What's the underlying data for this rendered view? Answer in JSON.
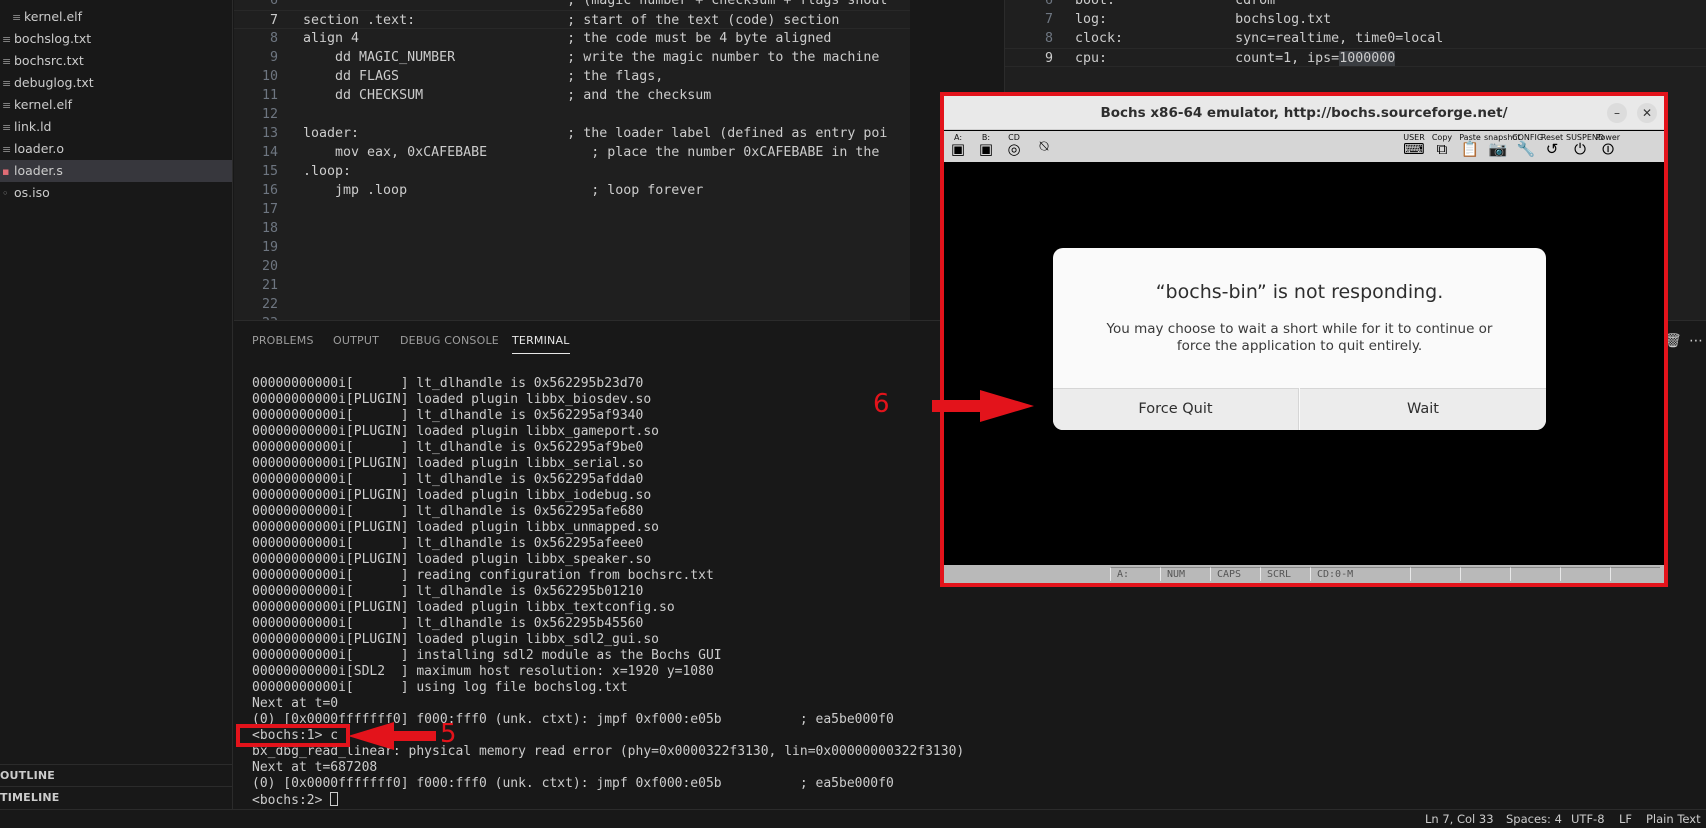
{
  "sidebar": {
    "files": [
      {
        "name": "kernel.elf",
        "icon": "text-file-icon",
        "indent": true
      },
      {
        "name": "bochslog.txt",
        "icon": "text-file-icon"
      },
      {
        "name": "bochsrc.txt",
        "icon": "text-file-icon"
      },
      {
        "name": "debuglog.txt",
        "icon": "text-file-icon"
      },
      {
        "name": "kernel.elf",
        "icon": "text-file-icon"
      },
      {
        "name": "link.ld",
        "icon": "text-file-icon"
      },
      {
        "name": "loader.o",
        "icon": "text-file-icon"
      },
      {
        "name": "loader.s",
        "icon": "asm-file-icon",
        "active": true
      },
      {
        "name": "os.iso",
        "icon": "disc-file-icon"
      }
    ],
    "outline_label": "OUTLINE",
    "timeline_label": "TIMELINE"
  },
  "editor_left": {
    "lines": [
      {
        "num": "6",
        "text": "                                 ; (magic number + checksum + flags shoul"
      },
      {
        "num": "7",
        "text": "section .text:                   ; start of the text (code) section",
        "current": true
      },
      {
        "num": "8",
        "text": "align 4                          ; the code must be 4 byte aligned"
      },
      {
        "num": "9",
        "text": "    dd MAGIC_NUMBER              ; write the magic number to the machine"
      },
      {
        "num": "10",
        "text": "    dd FLAGS                     ; the flags,"
      },
      {
        "num": "11",
        "text": "    dd CHECKSUM                  ; and the checksum"
      },
      {
        "num": "12",
        "text": ""
      },
      {
        "num": "13",
        "text": "loader:                          ; the loader label (defined as entry poi"
      },
      {
        "num": "14",
        "text": "    mov eax, 0xCAFEBABE             ; place the number 0xCAFEBABE in the"
      },
      {
        "num": "15",
        "text": ".loop:"
      },
      {
        "num": "16",
        "text": "    jmp .loop                       ; loop forever"
      },
      {
        "num": "17",
        "text": ""
      },
      {
        "num": "18",
        "text": ""
      },
      {
        "num": "19",
        "text": ""
      },
      {
        "num": "20",
        "text": ""
      },
      {
        "num": "21",
        "text": ""
      },
      {
        "num": "22",
        "text": ""
      },
      {
        "num": "23",
        "text": ""
      }
    ]
  },
  "editor_right": {
    "lines": [
      {
        "num": "6",
        "text": "boot:               cdrom"
      },
      {
        "num": "7",
        "text": "log:                bochslog.txt"
      },
      {
        "num": "8",
        "text": "clock:              sync=realtime, time0=local"
      },
      {
        "num": "9",
        "text": "cpu:                count=1, ips=",
        "selected": "1000000",
        "current": true
      }
    ]
  },
  "panel": {
    "tabs": [
      "PROBLEMS",
      "OUTPUT",
      "DEBUG CONSOLE",
      "TERMINAL"
    ],
    "active_tab": "TERMINAL",
    "terminal_lines": [
      "00000000000i[      ] lt_dlhandle is 0x562295b23d70",
      "00000000000i[PLUGIN] loaded plugin libbx_biosdev.so",
      "00000000000i[      ] lt_dlhandle is 0x562295af9340",
      "00000000000i[PLUGIN] loaded plugin libbx_gameport.so",
      "00000000000i[      ] lt_dlhandle is 0x562295af9be0",
      "00000000000i[PLUGIN] loaded plugin libbx_serial.so",
      "00000000000i[      ] lt_dlhandle is 0x562295afdda0",
      "00000000000i[PLUGIN] loaded plugin libbx_iodebug.so",
      "00000000000i[      ] lt_dlhandle is 0x562295afe680",
      "00000000000i[PLUGIN] loaded plugin libbx_unmapped.so",
      "00000000000i[      ] lt_dlhandle is 0x562295afeee0",
      "00000000000i[PLUGIN] loaded plugin libbx_speaker.so",
      "00000000000i[      ] reading configuration from bochsrc.txt",
      "00000000000i[      ] lt_dlhandle is 0x562295b01210",
      "00000000000i[PLUGIN] loaded plugin libbx_textconfig.so",
      "00000000000i[      ] lt_dlhandle is 0x562295b45560",
      "00000000000i[PLUGIN] loaded plugin libbx_sdl2_gui.so",
      "00000000000i[      ] installing sdl2 module as the Bochs GUI",
      "00000000000i[SDL2  ] maximum host resolution: x=1920 y=1080",
      "00000000000i[      ] using log file bochslog.txt",
      "Next at t=0",
      "(0) [0x0000fffffff0] f000:fff0 (unk. ctxt): jmpf 0xf000:e05b          ; ea5be000f0",
      "<bochs:1> c",
      "bx_dbg_read_linear: physical memory read error (phy=0x0000322f3130, lin=0x00000000322f3130)",
      "Next at t=687208",
      "(0) [0x0000fffffff0] f000:fff0 (unk. ctxt): jmpf 0xf000:e05b          ; ea5be000f0",
      "<bochs:2> "
    ]
  },
  "statusbar": {
    "position": "Ln 7, Col 33",
    "spaces": "Spaces: 4",
    "encoding": "UTF-8",
    "eol": "LF",
    "language": "Plain Text"
  },
  "bochs": {
    "title": "Bochs x86-64 emulator, http://bochs.sourceforge.net/",
    "toolbar_left": [
      "A:",
      "B:",
      "CD"
    ],
    "toolbar_right": [
      "USER",
      "Copy",
      "Paste",
      "snapshot",
      "CONFIG",
      "Reset",
      "SUSPEND",
      "Power"
    ],
    "status_cells": [
      "A:",
      "NUM",
      "CAPS",
      "SCRL",
      "CD:0-M",
      "",
      "",
      "",
      "",
      ""
    ]
  },
  "dialog": {
    "title": "“bochs-bin” is not responding.",
    "body": "You may choose to wait a short while for it to continue or force the application to quit entirely.",
    "force_quit_label": "Force Quit",
    "wait_label": "Wait"
  },
  "annotations": {
    "step5": "5",
    "step6": "6",
    "color": "#e3131b"
  },
  "colors": {
    "editor_bg": "#1f1f1f",
    "sidebar_bg": "#181818",
    "active_item_bg": "#37373d",
    "annotation_red": "#e3131b"
  }
}
